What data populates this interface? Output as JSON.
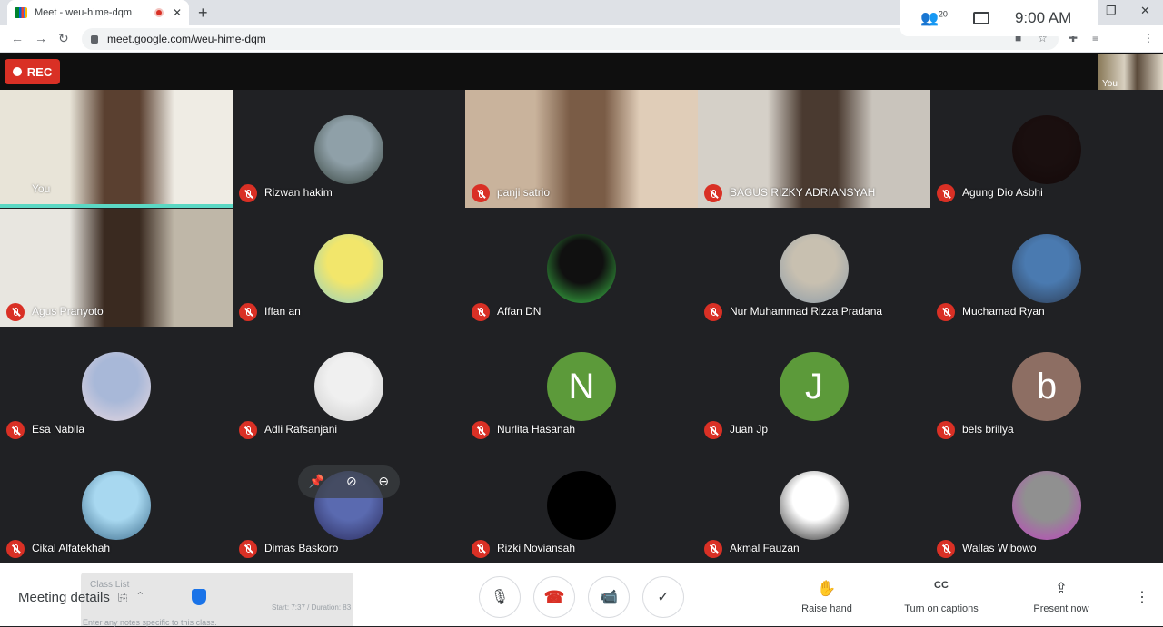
{
  "browser": {
    "tab_title": "Meet - weu-hime-dqm",
    "tab_close": "✕",
    "new_tab": "+",
    "url": "meet.google.com/weu-hime-dqm",
    "win_min": "–",
    "win_max": "❐",
    "win_close": "✕"
  },
  "topbar": {
    "rec_label": "REC",
    "participant_count": "20",
    "time": "9:00  AM",
    "self_label": "You"
  },
  "participants": [
    {
      "name": "You",
      "type": "video",
      "colors": [
        "#e8e4d8",
        "#5a4030",
        "#efece4"
      ]
    },
    {
      "name": "Rizwan hakim",
      "type": "photo",
      "colors": [
        "#8fa0a8",
        "#33403a"
      ]
    },
    {
      "name": "panji satrio",
      "type": "video",
      "colors": [
        "#c9b39c",
        "#7a5c46",
        "#e0cdb8"
      ]
    },
    {
      "name": "BAGUS RIZKY ADRIANSYAH",
      "type": "video",
      "colors": [
        "#d5d0c8",
        "#4a3a30",
        "#c9c4bc"
      ]
    },
    {
      "name": "Agung Dio Asbhi",
      "type": "photo",
      "colors": [
        "#1a0f0f",
        "#140909"
      ]
    },
    {
      "name": "Agus Pranyoto",
      "type": "video",
      "colors": [
        "#e8e6e0",
        "#3a2a20",
        "#bfb7a8"
      ]
    },
    {
      "name": "Iffan an",
      "type": "photo",
      "colors": [
        "#f2e66b",
        "#8fd0c8"
      ]
    },
    {
      "name": "Affan DN",
      "type": "photo",
      "colors": [
        "#101010",
        "#3ec84a"
      ]
    },
    {
      "name": "Nur Muhammad Rizza Pradana",
      "type": "photo",
      "colors": [
        "#c8c0b0",
        "#8a9aa8"
      ]
    },
    {
      "name": "Muchamad Ryan",
      "type": "photo",
      "colors": [
        "#4a7ab0",
        "#2c3a50"
      ]
    },
    {
      "name": "Esa Nabila",
      "type": "photo",
      "colors": [
        "#a8b8d8",
        "#e8d8e0"
      ]
    },
    {
      "name": "Adli Rafsanjani",
      "type": "photo",
      "colors": [
        "#f0f0f0",
        "#cccccc"
      ]
    },
    {
      "name": "Nurlita Hasanah",
      "type": "letter",
      "letter": "N",
      "colors": [
        "#5c9a3a"
      ]
    },
    {
      "name": "Juan Jp",
      "type": "letter",
      "letter": "J",
      "colors": [
        "#5c9a3a"
      ]
    },
    {
      "name": "bels brillya",
      "type": "letter",
      "letter": "b",
      "colors": [
        "#8d6e63"
      ]
    },
    {
      "name": "Cikal Alfatekhah",
      "type": "photo",
      "colors": [
        "#a8d8f0",
        "#3a6a8a"
      ]
    },
    {
      "name": "Dimas Baskoro",
      "type": "photo",
      "colors": [
        "#5a6ab0",
        "#2a2a5a"
      ]
    },
    {
      "name": "Rizki Noviansah",
      "type": "photo",
      "colors": [
        "#000000",
        "#000000"
      ]
    },
    {
      "name": "Akmal Fauzan",
      "type": "photo",
      "colors": [
        "#ffffff",
        "#202020"
      ]
    },
    {
      "name": "Wallas Wibowo",
      "type": "photo",
      "colors": [
        "#909090",
        "#c040c0"
      ]
    }
  ],
  "bottom": {
    "meeting_details": "Meeting details",
    "ghost_line1": "Class List",
    "ghost_line2": "Start: 7:37 / Duration: 83",
    "ghost_line3": "Enter any notes specific to this class.",
    "raise_hand": "Raise hand",
    "captions": "Turn on captions",
    "present": "Present now",
    "mic_icon": "🎙",
    "end_icon": "☎",
    "cam_icon": "📹",
    "check_icon": "✓",
    "hand_icon": "✋",
    "cc_icon": "CC",
    "present_icon": "⇪",
    "more_icon": "⋮"
  },
  "accent": {
    "red": "#d93025",
    "speaking": "#5bd8c4"
  }
}
